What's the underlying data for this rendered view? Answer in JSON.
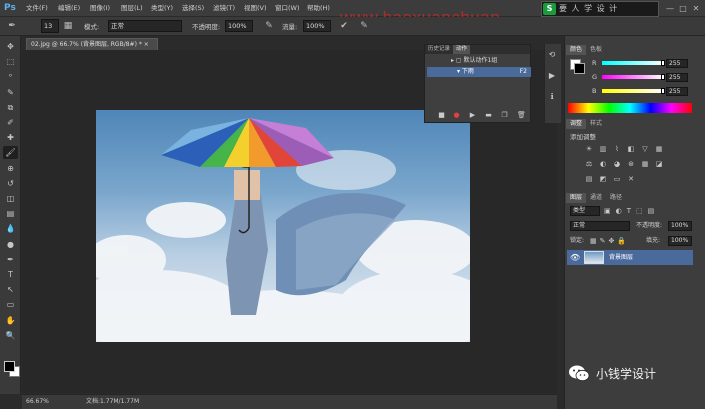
{
  "app": {
    "logo": "Ps"
  },
  "menu": {
    "items": [
      "文件(F)",
      "编辑(E)",
      "图像(I)",
      "图层(L)",
      "类型(Y)",
      "选择(S)",
      "滤镜(T)",
      "视图(V)",
      "窗口(W)",
      "帮助(H)"
    ]
  },
  "watermark": {
    "text": "要 人 学 设 计",
    "logo": "S",
    "url": "www.haoxuanchuan"
  },
  "window_controls": [
    "—",
    "□",
    "✕"
  ],
  "options": {
    "brush_size": "13",
    "mode_label": "模式:",
    "mode_value": "正常",
    "opacity_label": "不透明度:",
    "opacity_value": "100%",
    "flow_label": "流量:",
    "flow_value": "100%"
  },
  "document": {
    "tab_title": "02.jpg @ 66.7% (背景图层, RGB/8#) *",
    "tab_close": "×"
  },
  "status": {
    "zoom": "66.67%",
    "doc_info": "文档:1.77M/1.77M"
  },
  "actions_panel": {
    "tabs": [
      "历史记录",
      "动作"
    ],
    "rows": [
      "默认动作1组",
      "下雨"
    ],
    "shortcut": "F2"
  },
  "color_panel": {
    "tabs": [
      "颜色",
      "色板"
    ],
    "channels": [
      {
        "label": "R",
        "value": "255"
      },
      {
        "label": "G",
        "value": "255"
      },
      {
        "label": "B",
        "value": "255"
      }
    ]
  },
  "adjustments_panel": {
    "tabs": [
      "调整",
      "样式"
    ],
    "title": "添加调整"
  },
  "layers_panel": {
    "tabs": [
      "图层",
      "通道",
      "路径"
    ],
    "kind_label": "类型",
    "blend_mode": "正常",
    "opacity_label": "不透明度:",
    "opacity_value": "100%",
    "lock_label": "锁定:",
    "fill_label": "填充:",
    "fill_value": "100%",
    "layers": [
      {
        "name": "背景图层"
      }
    ]
  },
  "overlay": {
    "wechat_name": "小钱学设计"
  },
  "colors": {
    "accent": "#4b6a9c",
    "ps_blue": "#5fb0ef"
  },
  "icons": {
    "tools": [
      "move-icon",
      "marquee-icon",
      "lasso-icon",
      "quick-select-icon",
      "crop-icon",
      "eyedropper-icon",
      "healing-icon",
      "brush-icon",
      "clone-stamp-icon",
      "history-brush-icon",
      "eraser-icon",
      "gradient-icon",
      "blur-icon",
      "dodge-icon",
      "pen-icon",
      "type-icon",
      "path-select-icon",
      "shape-icon",
      "hand-icon",
      "zoom-icon"
    ]
  }
}
